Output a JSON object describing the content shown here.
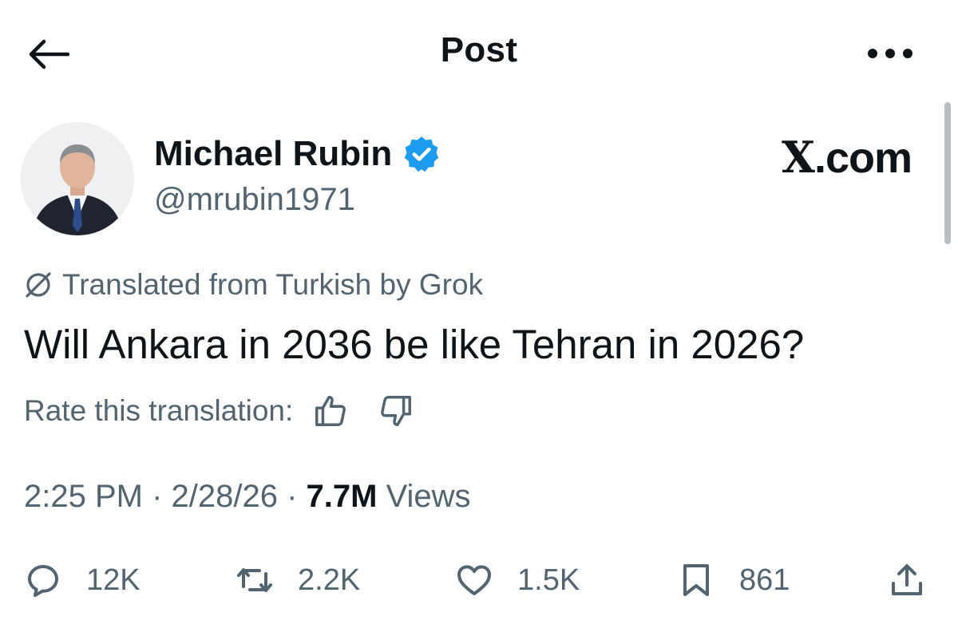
{
  "header": {
    "title": "Post",
    "back_icon": "arrow-left-icon",
    "more_icon": "more-horizontal-icon"
  },
  "author": {
    "name": "Michael Rubin",
    "handle": "@mrubin1971",
    "verified_icon": "verified-badge-icon",
    "verified_color": "#1d9bf0"
  },
  "brand": {
    "logo_glyph": "X",
    "logo_suffix": ".com"
  },
  "translation": {
    "notice": "Translated from Turkish by Grok",
    "notice_icon": "grok-icon",
    "rate_label": "Rate this translation:",
    "thumbs_up_icon": "thumbs-up-icon",
    "thumbs_down_icon": "thumbs-down-icon"
  },
  "post": {
    "text": "Will Ankara in 2036 be like Tehran in 2026?"
  },
  "meta": {
    "time": "2:25 PM",
    "separator": " · ",
    "date": "2/28/26",
    "views_count": "7.7M",
    "views_label": " Views"
  },
  "actions": {
    "replies": "12K",
    "reposts": "2.2K",
    "likes": "1.5K",
    "bookmarks": "861"
  },
  "colors": {
    "text_primary": "#0f1419",
    "text_secondary": "#536471",
    "background": "#ffffff"
  }
}
